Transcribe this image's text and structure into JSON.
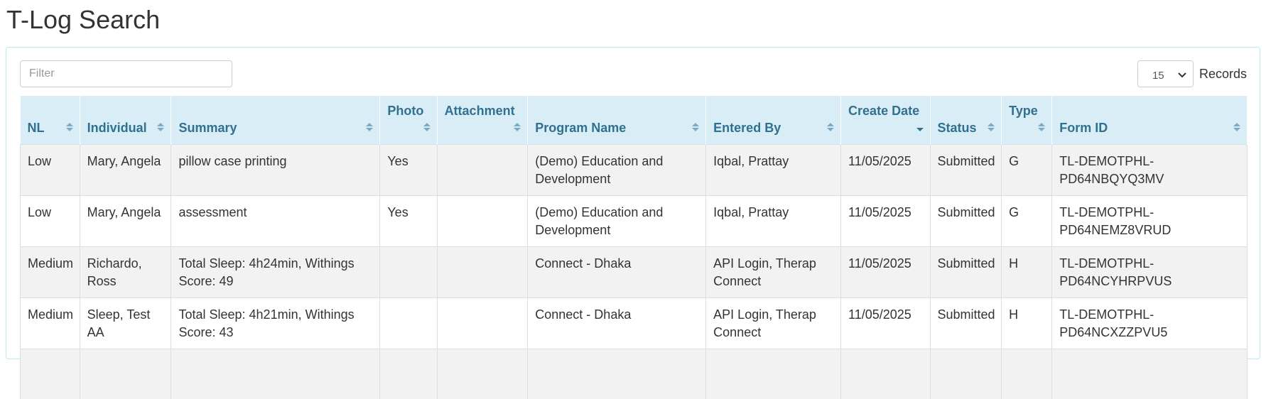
{
  "page": {
    "title": "T-Log Search"
  },
  "toolbar": {
    "filter_placeholder": "Filter",
    "filter_value": "",
    "records_value": "15",
    "records_label": "Records"
  },
  "table": {
    "columns": [
      {
        "key": "nl",
        "label": "NL"
      },
      {
        "key": "individual",
        "label": "Individual"
      },
      {
        "key": "summary",
        "label": "Summary"
      },
      {
        "key": "photo",
        "label": "Photo"
      },
      {
        "key": "attachment",
        "label": "Attachment"
      },
      {
        "key": "program",
        "label": "Program Name"
      },
      {
        "key": "entered_by",
        "label": "Entered By"
      },
      {
        "key": "create_date",
        "label": "Create Date",
        "sorted": "desc"
      },
      {
        "key": "status",
        "label": "Status"
      },
      {
        "key": "type",
        "label": "Type"
      },
      {
        "key": "form_id",
        "label": "Form ID"
      }
    ],
    "rows": [
      {
        "nl": "Low",
        "individual": "Mary, Angela",
        "summary": "pillow case printing",
        "photo": "Yes",
        "attachment": "",
        "program": "(Demo) Education and Development",
        "entered_by": "Iqbal, Prattay",
        "create_date": "11/05/2025",
        "status": "Submitted",
        "type": "G",
        "form_id": "TL-DEMOTPHL-PD64NBQYQ3MV"
      },
      {
        "nl": "Low",
        "individual": "Mary, Angela",
        "summary": "assessment",
        "photo": "Yes",
        "attachment": "",
        "program": "(Demo) Education and Development",
        "entered_by": "Iqbal, Prattay",
        "create_date": "11/05/2025",
        "status": "Submitted",
        "type": "G",
        "form_id": "TL-DEMOTPHL-PD64NEMZ8VRUD"
      },
      {
        "nl": "Medium",
        "individual": "Richardo, Ross",
        "summary": "Total Sleep: 4h24min, Withings Score: 49",
        "photo": "",
        "attachment": "",
        "program": "Connect - Dhaka",
        "entered_by": "API Login, Therap Connect",
        "create_date": "11/05/2025",
        "status": "Submitted",
        "type": "H",
        "form_id": "TL-DEMOTPHL-PD64NCYHRPVUS"
      },
      {
        "nl": "Medium",
        "individual": "Sleep, Test AA",
        "summary": "Total Sleep: 4h21min, Withings Score: 43",
        "photo": "",
        "attachment": "",
        "program": "Connect - Dhaka",
        "entered_by": "API Login, Therap Connect",
        "create_date": "11/05/2025",
        "status": "Submitted",
        "type": "H",
        "form_id": "TL-DEMOTPHL-PD64NCXZZPVU5"
      },
      {
        "nl": "",
        "individual": "",
        "summary": "",
        "photo": "",
        "attachment": "",
        "program": "",
        "entered_by": "",
        "create_date": "",
        "status": "",
        "type": "",
        "form_id": ""
      }
    ]
  },
  "colors": {
    "header_bg": "#d9edf7",
    "header_text": "#31708f",
    "panel_border": "#bce8f1",
    "row_odd": "#f2f2f2",
    "sort_icon": "#7aaac6",
    "sort_icon_active": "#31708f"
  },
  "icons": {
    "sort": "sort-both-icon",
    "sort_desc": "sort-desc-icon",
    "select_chevron": "chevron-down-icon"
  }
}
